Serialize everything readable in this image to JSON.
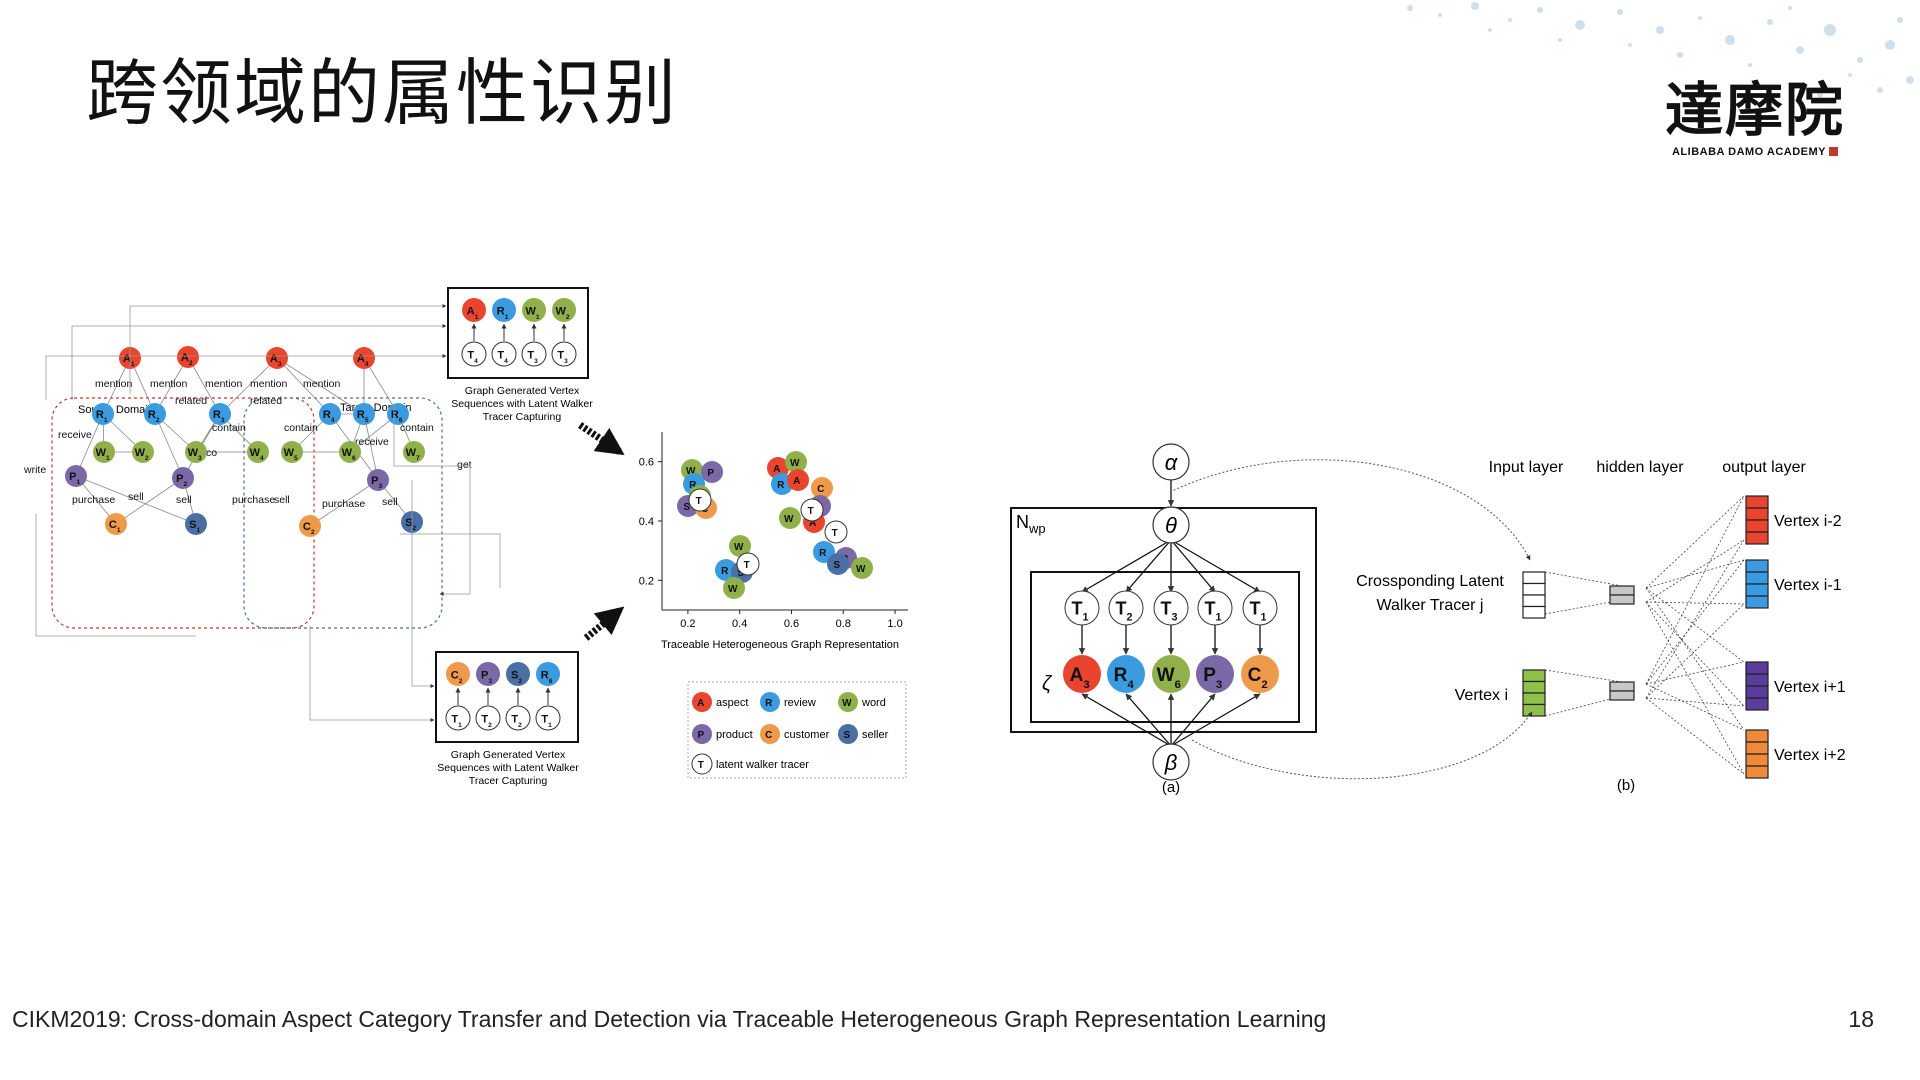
{
  "slide": {
    "title": "跨领域的属性识别",
    "footer": "CIKM2019:  Cross-domain Aspect Category Transfer and Detection via Traceable Heterogeneous Graph Representation Learning",
    "page_number": "18"
  },
  "logo": {
    "cn": "達摩院",
    "en": "ALIBABA DAMO ACADEMY"
  },
  "colors": {
    "aspect": "#e8442e",
    "review": "#3a9be0",
    "word": "#8fb04a",
    "product": "#7b68a6",
    "customer": "#ee9a4a",
    "seller": "#4a6fa5",
    "tracer": "#ffffff",
    "out1": "#e8442e",
    "out2": "#3a9be0",
    "out3": "#5a3c9c",
    "out4": "#ee8a3a",
    "input_green": "#8fc04a"
  },
  "left_diagram": {
    "source_domain": "Source Domain",
    "target_domain": "Target Domain",
    "caption": "Graph Generated Vertex\nSequences with Latent Walker\nTracer Capturing",
    "top_box": {
      "nodes": [
        {
          "letter": "A",
          "sub": "1",
          "type": "aspect"
        },
        {
          "letter": "R",
          "sub": "1",
          "type": "review"
        },
        {
          "letter": "W",
          "sub": "1",
          "type": "word"
        },
        {
          "letter": "W",
          "sub": "2",
          "type": "word"
        }
      ],
      "tracers": [
        {
          "letter": "T",
          "sub": "4"
        },
        {
          "letter": "T",
          "sub": "4"
        },
        {
          "letter": "T",
          "sub": "3"
        },
        {
          "letter": "T",
          "sub": "3"
        }
      ]
    },
    "bottom_box": {
      "nodes": [
        {
          "letter": "C",
          "sub": "2",
          "type": "customer"
        },
        {
          "letter": "P",
          "sub": "3",
          "type": "product"
        },
        {
          "letter": "S",
          "sub": "2",
          "type": "seller"
        },
        {
          "letter": "R",
          "sub": "6",
          "type": "review"
        }
      ],
      "tracers": [
        {
          "letter": "T",
          "sub": "1"
        },
        {
          "letter": "T",
          "sub": "2"
        },
        {
          "letter": "T",
          "sub": "2"
        },
        {
          "letter": "T",
          "sub": "1"
        }
      ]
    },
    "graph_nodes": [
      {
        "letter": "A",
        "sub": "1",
        "type": "aspect"
      },
      {
        "letter": "A",
        "sub": "2",
        "type": "aspect"
      },
      {
        "letter": "A",
        "sub": "3",
        "type": "aspect"
      },
      {
        "letter": "A",
        "sub": "4",
        "type": "aspect"
      },
      {
        "letter": "R",
        "sub": "1",
        "type": "review"
      },
      {
        "letter": "R",
        "sub": "2",
        "type": "review"
      },
      {
        "letter": "R",
        "sub": "3",
        "type": "review"
      },
      {
        "letter": "R",
        "sub": "4",
        "type": "review"
      },
      {
        "letter": "R",
        "sub": "5",
        "type": "review"
      },
      {
        "letter": "R",
        "sub": "6",
        "type": "review"
      },
      {
        "letter": "W",
        "sub": "1",
        "type": "word"
      },
      {
        "letter": "W",
        "sub": "2",
        "type": "word"
      },
      {
        "letter": "W",
        "sub": "3",
        "type": "word"
      },
      {
        "letter": "W",
        "sub": "4",
        "type": "word"
      },
      {
        "letter": "W",
        "sub": "5",
        "type": "word"
      },
      {
        "letter": "W",
        "sub": "6",
        "type": "word"
      },
      {
        "letter": "W",
        "sub": "7",
        "type": "word"
      },
      {
        "letter": "P",
        "sub": "1",
        "type": "product"
      },
      {
        "letter": "P",
        "sub": "2",
        "type": "product"
      },
      {
        "letter": "P",
        "sub": "3",
        "type": "product"
      },
      {
        "letter": "C",
        "sub": "1",
        "type": "customer"
      },
      {
        "letter": "C",
        "sub": "2",
        "type": "customer"
      },
      {
        "letter": "S",
        "sub": "1",
        "type": "seller"
      },
      {
        "letter": "S",
        "sub": "2",
        "type": "seller"
      }
    ],
    "edge_labels": [
      "mention",
      "mention",
      "mention",
      "mention",
      "mention",
      "related",
      "related",
      "receive",
      "contain",
      "contain",
      "contain",
      "receive",
      "co",
      "co",
      "write",
      "get",
      "purchase",
      "sell",
      "sell",
      "purchase",
      "sell",
      "purchase",
      "sell"
    ]
  },
  "scatter": {
    "xlabel": "Traceable Heterogeneous Graph Representation",
    "xticks": [
      "0.2",
      "0.4",
      "0.6",
      "0.8",
      "1.0"
    ],
    "yticks": [
      "0.2",
      "0.4",
      "0.6"
    ],
    "legend": [
      {
        "letter": "A",
        "label": "aspect",
        "type": "aspect"
      },
      {
        "letter": "R",
        "label": "review",
        "type": "review"
      },
      {
        "letter": "W",
        "label": "word",
        "type": "word"
      },
      {
        "letter": "P",
        "label": "product",
        "type": "product"
      },
      {
        "letter": "C",
        "label": "customer",
        "type": "customer"
      },
      {
        "letter": "S",
        "label": "seller",
        "type": "seller"
      },
      {
        "letter": "T",
        "label": "latent walker tracer",
        "type": "tracer"
      }
    ]
  },
  "panel_a": {
    "alpha": "α",
    "theta": "θ",
    "beta": "β",
    "zeta": "ζ",
    "plate": "N",
    "plate_sub": "wp",
    "caption": "(a)",
    "tracers": [
      {
        "letter": "T",
        "sub": "1"
      },
      {
        "letter": "T",
        "sub": "2"
      },
      {
        "letter": "T",
        "sub": "3"
      },
      {
        "letter": "T",
        "sub": "1"
      },
      {
        "letter": "T",
        "sub": "1"
      }
    ],
    "nodes": [
      {
        "letter": "A",
        "sub": "3",
        "type": "aspect"
      },
      {
        "letter": "R",
        "sub": "4",
        "type": "review"
      },
      {
        "letter": "W",
        "sub": "6",
        "type": "word"
      },
      {
        "letter": "P",
        "sub": "3",
        "type": "product"
      },
      {
        "letter": "C",
        "sub": "2",
        "type": "customer"
      }
    ]
  },
  "panel_b": {
    "input_layer": "Input layer",
    "hidden_layer": "hidden layer",
    "output_layer": "output layer",
    "tracer_label_1": "Crossponding Latent",
    "tracer_label_2": "Walker Tracer j",
    "vertex_i": "Vertex i",
    "outputs": [
      "Vertex i-2",
      "Vertex i-1",
      "Vertex i+1",
      "Vertex i+2"
    ],
    "caption": "(b)"
  }
}
